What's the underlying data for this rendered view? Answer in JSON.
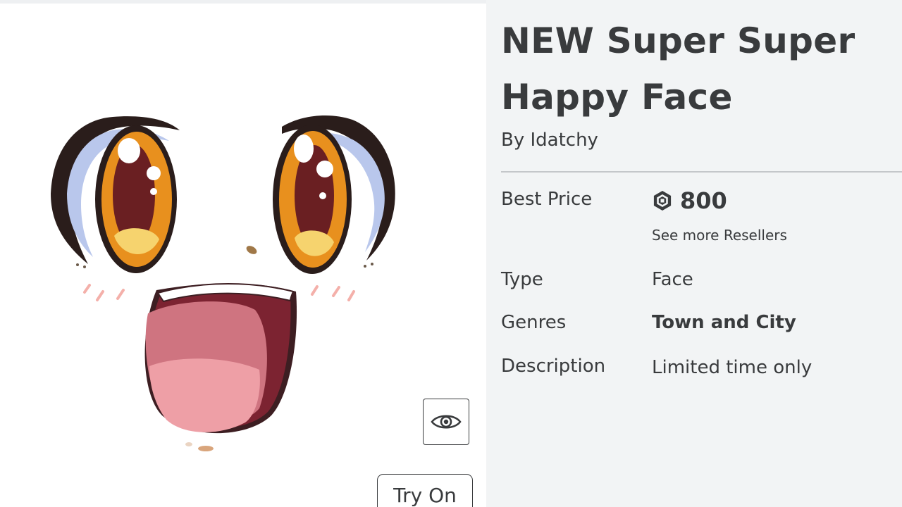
{
  "item": {
    "title": "NEW Super Super Happy Face",
    "by_line": "By Idatchy"
  },
  "details": {
    "best_price_label": "Best Price",
    "price": "800",
    "currency_icon": "robux-icon",
    "resellers_link": "See more Resellers",
    "type_label": "Type",
    "type_value": "Face",
    "genres_label": "Genres",
    "genres_value": "Town and City",
    "description_label": "Description",
    "description_value": "Limited time only"
  },
  "preview": {
    "toggle_icon": "eye-icon",
    "try_on_label": "Try On"
  },
  "colors": {
    "text": "#393b3d",
    "panel_bg": "#f2f4f5",
    "preview_bg": "#ffffff"
  }
}
